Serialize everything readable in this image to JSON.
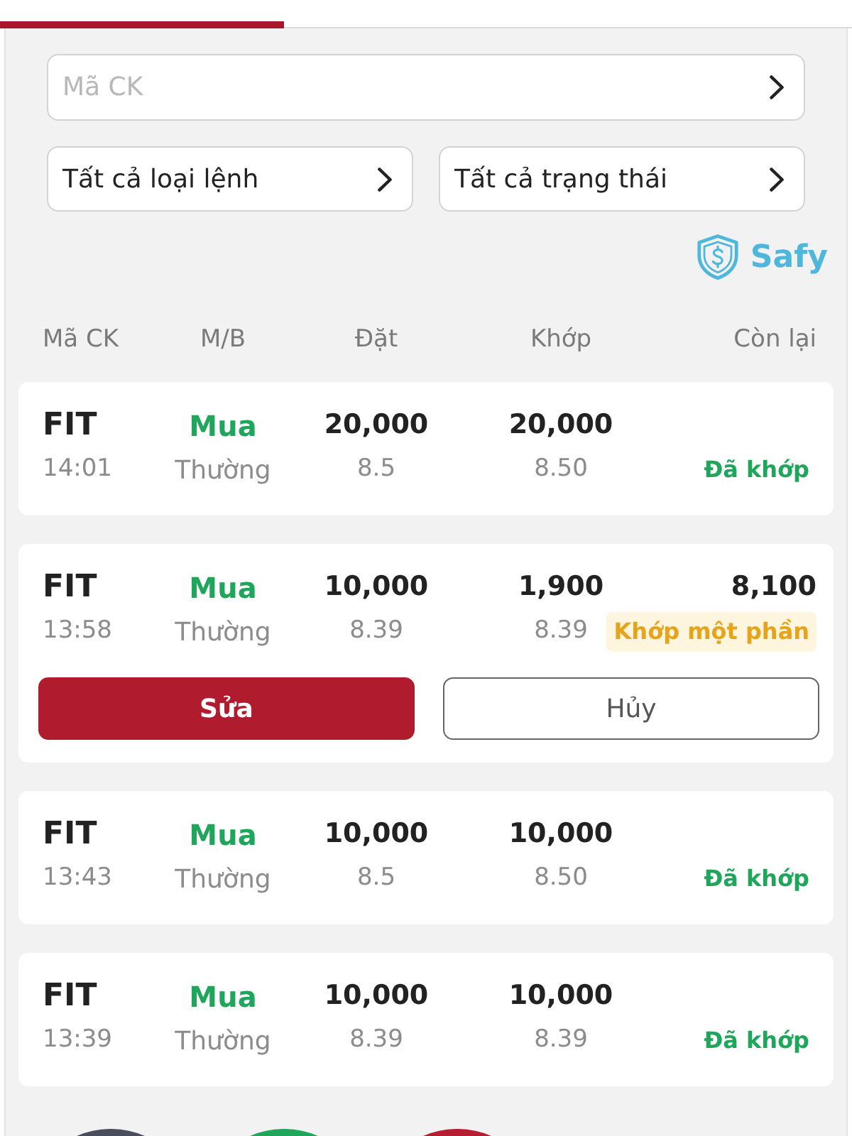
{
  "tabs": [
    {
      "selected": true
    },
    {
      "selected": false
    },
    {
      "selected": false
    }
  ],
  "filters": {
    "symbol": {
      "placeholder": "Mã CK"
    },
    "order_type": "Tất cả loại lệnh",
    "status": "Tất cả trạng thái"
  },
  "brand": {
    "name": "Safy"
  },
  "columns": [
    "Mã CK",
    "M/B",
    "Đặt",
    "Khớp",
    "Còn lại"
  ],
  "orders": [
    {
      "symbol": "FIT",
      "time": "14:01",
      "side": "Mua",
      "order_type": "Thường",
      "quantity": "20,000",
      "price": "8.5",
      "matched_quantity": "20,000",
      "matched_price": "8.50",
      "status": {
        "text": "Đã khớp",
        "kind": "filled"
      }
    },
    {
      "symbol": "FIT",
      "time": "13:58",
      "side": "Mua",
      "order_type": "Thường",
      "quantity": "10,000",
      "price": "8.39",
      "matched_quantity": "1,900",
      "matched_price": "8.39",
      "remaining": "8,100",
      "status": {
        "text": "Khớp một phần",
        "kind": "partial"
      },
      "actions": [
        {
          "label": "Sửa",
          "kind": "edit"
        },
        {
          "label": "Hủy",
          "kind": "cancel"
        }
      ]
    },
    {
      "symbol": "FIT",
      "time": "13:43",
      "side": "Mua",
      "order_type": "Thường",
      "quantity": "10,000",
      "price": "8.5",
      "matched_quantity": "10,000",
      "matched_price": "8.50",
      "status": {
        "text": "Đã khớp",
        "kind": "filled"
      }
    },
    {
      "symbol": "FIT",
      "time": "13:39",
      "side": "Mua",
      "order_type": "Thường",
      "quantity": "10,000",
      "price": "8.39",
      "matched_quantity": "10,000",
      "matched_price": "8.39",
      "status": {
        "text": "Đã khớp",
        "kind": "filled"
      }
    }
  ],
  "floating_buttons": [
    {
      "color": "#4a4e5c"
    },
    {
      "color": "#1fa65a"
    },
    {
      "color": "#b51d30"
    }
  ]
}
